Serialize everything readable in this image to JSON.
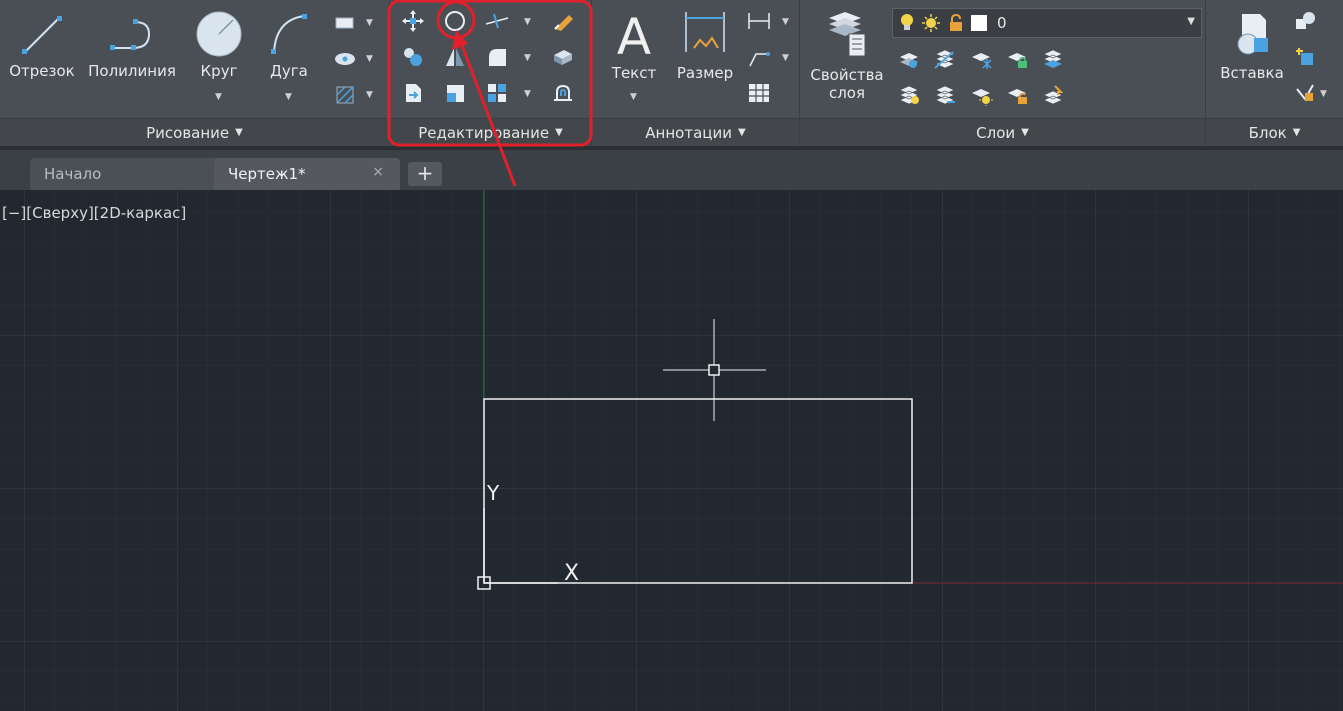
{
  "ribbon": {
    "draw_panel": {
      "title": "Рисование",
      "tools": {
        "line": "Отрезок",
        "polyline": "Полилиния",
        "circle": "Круг",
        "arc": "Дуга"
      }
    },
    "modify_panel": {
      "title": "Редактирование"
    },
    "annotation_panel": {
      "title": "Аннотации",
      "tools": {
        "text": "Текст",
        "dimension": "Размер"
      }
    },
    "layers_panel": {
      "title": "Слои",
      "properties_line1": "Свойства",
      "properties_line2": "слоя",
      "current_layer": "0"
    },
    "block_panel": {
      "title": "Блок",
      "insert": "Вставка"
    }
  },
  "tabs": {
    "start": "Начало",
    "drawing": "Чертеж1*",
    "close": "×",
    "add": "+"
  },
  "viewport": {
    "label": "[−][Сверху][2D-каркас]",
    "ucs_x": "X",
    "ucs_y": "Y"
  },
  "colors": {
    "ribbon_bg": "#4a4f55",
    "canvas_bg": "#212830",
    "highlight": "#e0202a",
    "icon_blue": "#4aa3e0"
  }
}
